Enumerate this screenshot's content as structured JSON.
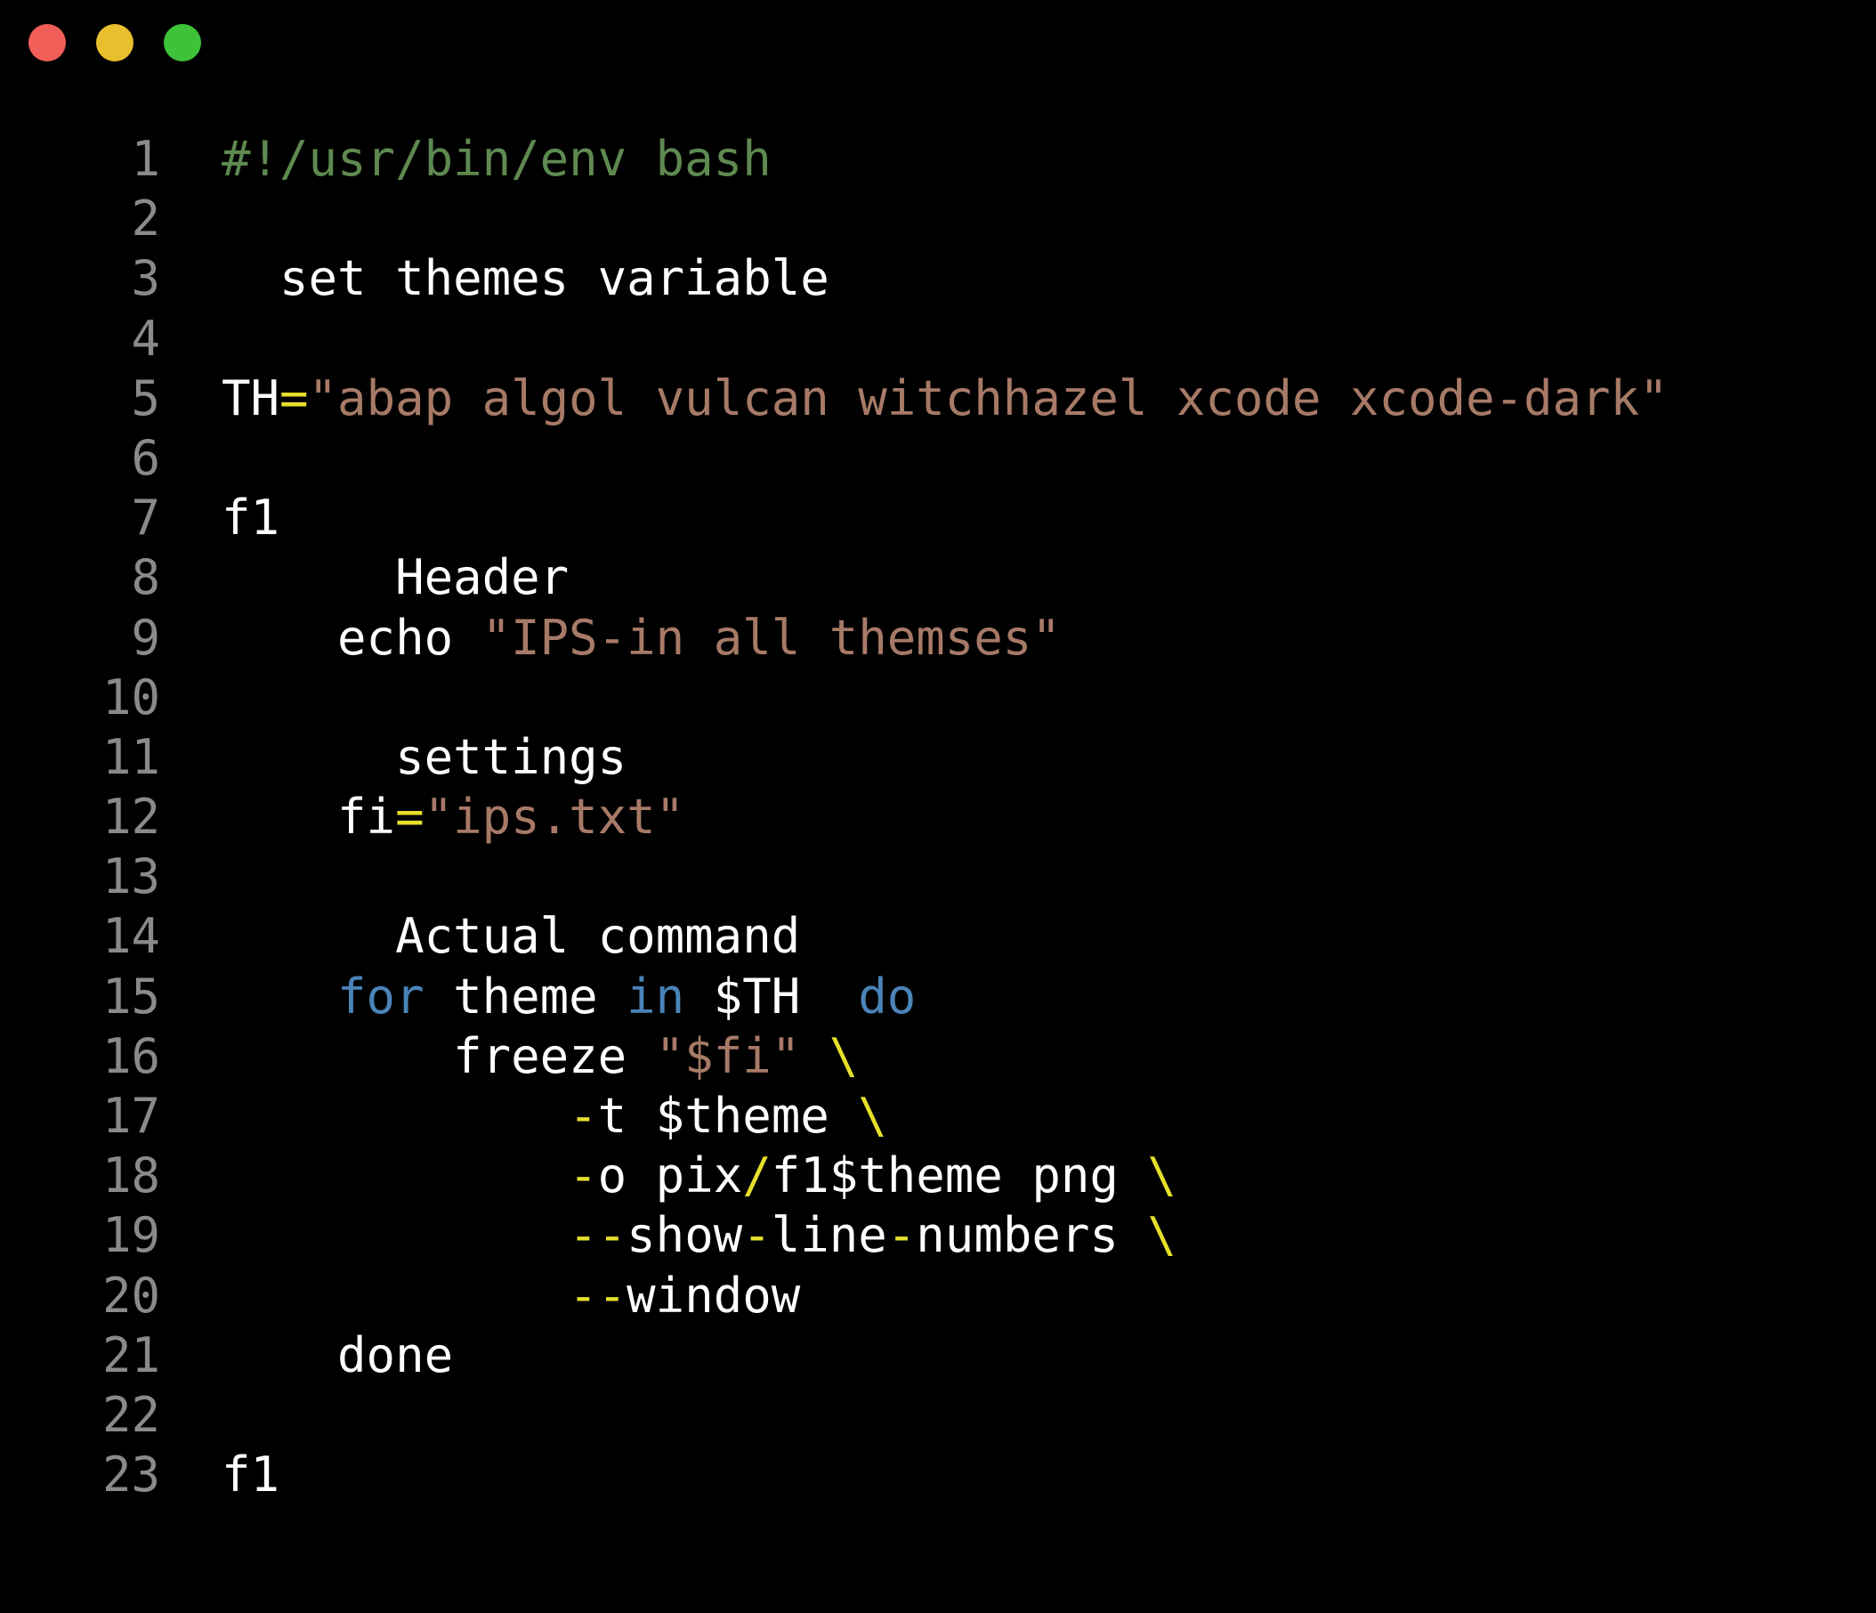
{
  "window": {
    "controls": [
      {
        "name": "close",
        "color": "#f15e57"
      },
      {
        "name": "minimize",
        "color": "#e8bf2d"
      },
      {
        "name": "maximize",
        "color": "#3ec23a"
      }
    ]
  },
  "colors": {
    "background": "#000000",
    "line_number": "#8a8a8a",
    "default": "#ffffff",
    "comment": "#5e8950",
    "string": "#a77a67",
    "keyword": "#4a84b8",
    "operator": "#e6df2b"
  },
  "code": {
    "lines": [
      {
        "num": "1",
        "tokens": [
          {
            "t": "#!/usr/bin/env bash",
            "k": "comment"
          }
        ]
      },
      {
        "num": "2",
        "tokens": []
      },
      {
        "num": "3",
        "tokens": [
          {
            "t": "  set themes variable",
            "k": "default"
          }
        ]
      },
      {
        "num": "4",
        "tokens": []
      },
      {
        "num": "5",
        "tokens": [
          {
            "t": "TH",
            "k": "default"
          },
          {
            "t": "=",
            "k": "operator"
          },
          {
            "t": "\"abap algol vulcan witchhazel xcode xcode-dark\"",
            "k": "string"
          }
        ]
      },
      {
        "num": "6",
        "tokens": []
      },
      {
        "num": "7",
        "tokens": [
          {
            "t": "f1",
            "k": "default"
          }
        ]
      },
      {
        "num": "8",
        "tokens": [
          {
            "t": "      Header",
            "k": "default"
          }
        ]
      },
      {
        "num": "9",
        "tokens": [
          {
            "t": "    echo ",
            "k": "default"
          },
          {
            "t": "\"IPS-in all themses\"",
            "k": "string"
          }
        ]
      },
      {
        "num": "10",
        "tokens": []
      },
      {
        "num": "11",
        "tokens": [
          {
            "t": "      settings",
            "k": "default"
          }
        ]
      },
      {
        "num": "12",
        "tokens": [
          {
            "t": "    fi",
            "k": "default"
          },
          {
            "t": "=",
            "k": "operator"
          },
          {
            "t": "\"ips.txt\"",
            "k": "string"
          }
        ]
      },
      {
        "num": "13",
        "tokens": []
      },
      {
        "num": "14",
        "tokens": [
          {
            "t": "      Actual command",
            "k": "default"
          }
        ]
      },
      {
        "num": "15",
        "tokens": [
          {
            "t": "    ",
            "k": "default"
          },
          {
            "t": "for",
            "k": "keyword"
          },
          {
            "t": " theme ",
            "k": "default"
          },
          {
            "t": "in",
            "k": "keyword"
          },
          {
            "t": " $TH  ",
            "k": "default"
          },
          {
            "t": "do",
            "k": "keyword"
          }
        ]
      },
      {
        "num": "16",
        "tokens": [
          {
            "t": "        freeze ",
            "k": "default"
          },
          {
            "t": "\"$fi\"",
            "k": "string"
          },
          {
            "t": " ",
            "k": "default"
          },
          {
            "t": "\\",
            "k": "operator"
          }
        ]
      },
      {
        "num": "17",
        "tokens": [
          {
            "t": "            ",
            "k": "default"
          },
          {
            "t": "-",
            "k": "operator"
          },
          {
            "t": "t $theme ",
            "k": "default"
          },
          {
            "t": "\\",
            "k": "operator"
          }
        ]
      },
      {
        "num": "18",
        "tokens": [
          {
            "t": "            ",
            "k": "default"
          },
          {
            "t": "-",
            "k": "operator"
          },
          {
            "t": "o pix",
            "k": "default"
          },
          {
            "t": "/",
            "k": "operator"
          },
          {
            "t": "f1$theme png ",
            "k": "default"
          },
          {
            "t": "\\",
            "k": "operator"
          }
        ]
      },
      {
        "num": "19",
        "tokens": [
          {
            "t": "            ",
            "k": "default"
          },
          {
            "t": "--",
            "k": "operator"
          },
          {
            "t": "show",
            "k": "default"
          },
          {
            "t": "-",
            "k": "operator"
          },
          {
            "t": "line",
            "k": "default"
          },
          {
            "t": "-",
            "k": "operator"
          },
          {
            "t": "numbers ",
            "k": "default"
          },
          {
            "t": "\\",
            "k": "operator"
          }
        ]
      },
      {
        "num": "20",
        "tokens": [
          {
            "t": "            ",
            "k": "default"
          },
          {
            "t": "--",
            "k": "operator"
          },
          {
            "t": "window",
            "k": "default"
          }
        ]
      },
      {
        "num": "21",
        "tokens": [
          {
            "t": "    done",
            "k": "default"
          }
        ]
      },
      {
        "num": "22",
        "tokens": []
      },
      {
        "num": "23",
        "tokens": [
          {
            "t": "f1",
            "k": "default"
          }
        ]
      }
    ]
  }
}
